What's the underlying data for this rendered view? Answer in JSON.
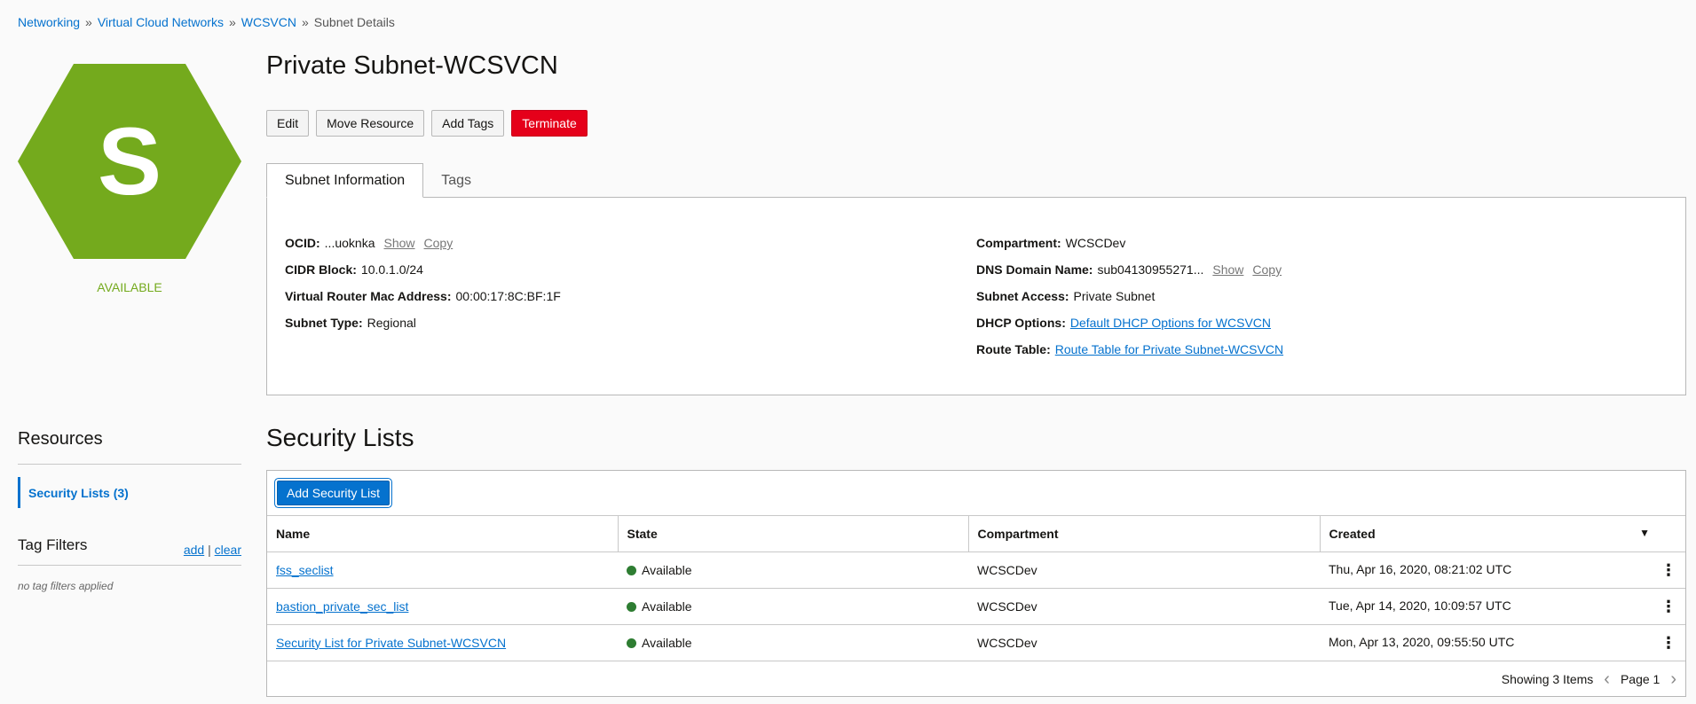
{
  "breadcrumb": {
    "items": [
      "Networking",
      "Virtual Cloud Networks",
      "WCSVCN"
    ],
    "separator": "»",
    "current": "Subnet Details"
  },
  "resource": {
    "letter": "S",
    "status": "AVAILABLE",
    "hex_color": "#74aa1d",
    "title": "Private Subnet-WCSVCN"
  },
  "actions": {
    "edit": "Edit",
    "move": "Move Resource",
    "add_tags": "Add Tags",
    "terminate": "Terminate"
  },
  "tabs": {
    "info": "Subnet Information",
    "tags": "Tags"
  },
  "info": {
    "ocid_label": "OCID:",
    "ocid_value": "...uoknka",
    "show": "Show",
    "copy": "Copy",
    "cidr_label": "CIDR Block:",
    "cidr_value": "10.0.1.0/24",
    "mac_label": "Virtual Router Mac Address:",
    "mac_value": "00:00:17:8C:BF:1F",
    "type_label": "Subnet Type:",
    "type_value": "Regional",
    "compartment_label": "Compartment:",
    "compartment_value": "WCSCDev",
    "dns_label": "DNS Domain Name:",
    "dns_value": "sub04130955271...",
    "access_label": "Subnet Access:",
    "access_value": "Private Subnet",
    "dhcp_label": "DHCP Options:",
    "dhcp_value": "Default DHCP Options for WCSVCN",
    "route_label": "Route Table:",
    "route_value": "Route Table for Private Subnet-WCSVCN"
  },
  "sidebar": {
    "resources_title": "Resources",
    "security_lists_item": "Security Lists (3)",
    "tag_filters_title": "Tag Filters",
    "add": "add",
    "pipe": "|",
    "clear": "clear",
    "no_tags": "no tag filters applied"
  },
  "security_lists": {
    "title": "Security Lists",
    "add_button": "Add Security List",
    "columns": [
      "Name",
      "State",
      "Compartment",
      "Created"
    ],
    "rows": [
      {
        "name": "fss_seclist",
        "state": "Available",
        "compartment": "WCSCDev",
        "created": "Thu, Apr 16, 2020, 08:21:02 UTC"
      },
      {
        "name": "bastion_private_sec_list",
        "state": "Available",
        "compartment": "WCSCDev",
        "created": "Tue, Apr 14, 2020, 10:09:57 UTC"
      },
      {
        "name": "Security List for Private Subnet-WCSVCN",
        "state": "Available",
        "compartment": "WCSCDev",
        "created": "Mon, Apr 13, 2020, 09:55:50 UTC"
      }
    ],
    "state_color": "#2e7d32",
    "showing": "Showing 3 Items",
    "page": "Page 1"
  }
}
